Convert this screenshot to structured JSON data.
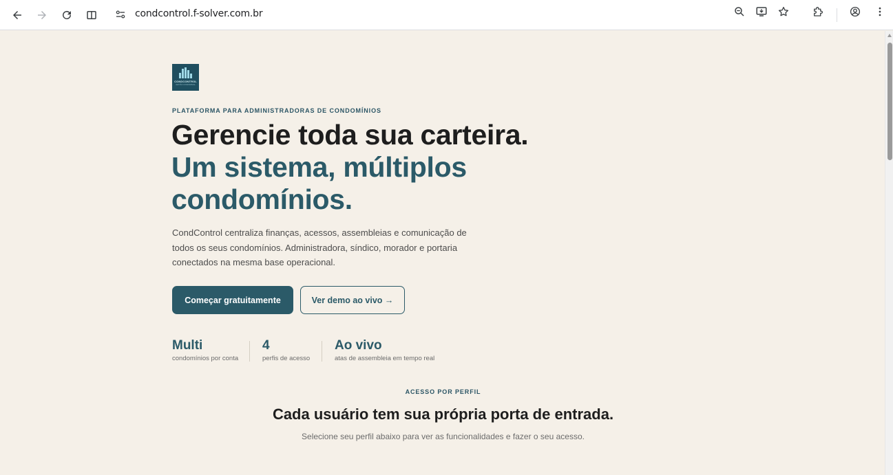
{
  "browser": {
    "url": "condcontrol.f-solver.com.br"
  },
  "hero": {
    "eyebrow": "PLATAFORMA PARA ADMINISTRADORAS DE CONDOMÍNIOS",
    "headline_line1": "Gerencie toda sua carteira.",
    "headline_accent_line1": "Um sistema, múltiplos",
    "headline_accent_line2": "condomínios.",
    "lead": "CondControl centraliza finanças, acessos, assembleias e comunicação de todos os seus condomínios. Administradora, síndico, morador e portaria conectados na mesma base operacional.",
    "primary_cta": "Começar gratuitamente",
    "secondary_cta": "Ver demo ao vivo →"
  },
  "logo": {
    "text": "CONDCONTROL",
    "subtext": "GESTÃO CONDOMINIAL"
  },
  "stats": [
    {
      "value": "Multi",
      "label": "condomínios por conta"
    },
    {
      "value": "4",
      "label": "perfis de acesso"
    },
    {
      "value": "Ao vivo",
      "label": "atas de assembleia em tempo real"
    }
  ],
  "profiles_section": {
    "eyebrow": "ACESSO POR PERFIL",
    "title": "Cada usuário tem sua própria porta de entrada.",
    "subtitle": "Selecione seu perfil abaixo para ver as funcionalidades e fazer o seu acesso."
  },
  "colors": {
    "accent": "#2b5a68",
    "background": "#f5f0e8",
    "text": "#1e1e1e"
  }
}
